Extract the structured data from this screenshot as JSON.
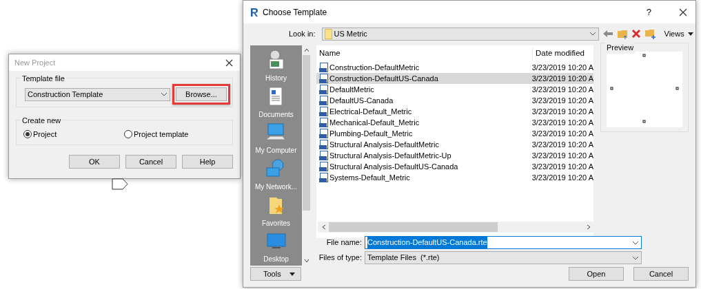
{
  "new_project": {
    "title": "New Project",
    "template_group": "Template file",
    "template_value": "Construction Template",
    "browse_button": {
      "label": "Browse...",
      "highlighted": true
    },
    "create_group": "Create new",
    "options": [
      {
        "label": "Project",
        "selected": true
      },
      {
        "label": "Project template",
        "selected": false
      }
    ],
    "buttons": [
      "OK",
      "Cancel",
      "Help"
    ]
  },
  "choose_template": {
    "title": "Choose Template",
    "help": "?",
    "look_in_label": "Look in:",
    "look_in_value": "US Metric",
    "views": "Views",
    "places": [
      {
        "kind": "history",
        "label": "History"
      },
      {
        "kind": "documents",
        "label": "Documents"
      },
      {
        "kind": "computer",
        "label": "My Computer"
      },
      {
        "kind": "network",
        "label": "My Network..."
      },
      {
        "kind": "favorites",
        "label": "Favorites"
      },
      {
        "kind": "desktop",
        "label": "Desktop"
      }
    ],
    "columns": [
      "Name",
      "Date modified"
    ],
    "files": [
      {
        "name": "Construction-DefaultMetric",
        "date": "3/23/2019 10:20 A",
        "selected": false
      },
      {
        "name": "Construction-DefaultUS-Canada",
        "date": "3/23/2019 10:20 A",
        "selected": true
      },
      {
        "name": "DefaultMetric",
        "date": "3/23/2019 10:20 A",
        "selected": false
      },
      {
        "name": "DefaultUS-Canada",
        "date": "3/23/2019 10:20 A",
        "selected": false
      },
      {
        "name": "Electrical-Default_Metric",
        "date": "3/23/2019 10:20 A",
        "selected": false
      },
      {
        "name": "Mechanical-Default_Metric",
        "date": "3/23/2019 10:20 A",
        "selected": false
      },
      {
        "name": "Plumbing-Default_Metric",
        "date": "3/23/2019 10:20 A",
        "selected": false
      },
      {
        "name": "Structural Analysis-DefaultMetric",
        "date": "3/23/2019 10:20 A",
        "selected": false
      },
      {
        "name": "Structural Analysis-DefaultMetric-Up",
        "date": "3/23/2019 10:20 A",
        "selected": false
      },
      {
        "name": "Structural Analysis-DefaultUS-Canada",
        "date": "3/23/2019 10:20 A",
        "selected": false
      },
      {
        "name": "Systems-Default_Metric",
        "date": "3/23/2019 10:20 A",
        "selected": false
      }
    ],
    "preview_label": "Preview",
    "file_name_label": "File name:",
    "file_name_value": "Construction-DefaultUS-Canada.rte",
    "file_type_label": "Files of type:",
    "file_type_value": "Template Files  (*.rte)",
    "tools": "Tools",
    "open": "Open",
    "cancel": "Cancel"
  }
}
